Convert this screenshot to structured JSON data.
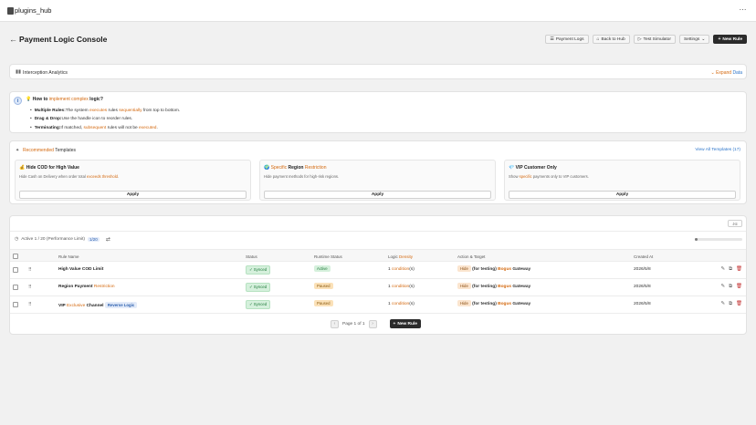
{
  "app": {
    "title": "plugins_hub",
    "menu_icon": "⋯"
  },
  "header": {
    "title": "Payment Logic Console",
    "buttons": [
      {
        "icon": "☰",
        "label": "Payment Logs"
      },
      {
        "icon": "⌂",
        "label": "Back to Hub"
      },
      {
        "icon": "▷",
        "label": "Test Simulator"
      },
      {
        "icon": "",
        "label": "Settings"
      }
    ],
    "new_rule": "New Rule"
  },
  "analytics": {
    "title": "Interception Analytics",
    "expand_a": "Expand",
    "expand_b": "Data"
  },
  "howto": {
    "title_a": "How to",
    "title_b": "implement complex",
    "title_c": "logic?",
    "tips": [
      {
        "bold": "Multiple Rules:",
        "a": "The system ",
        "b": "executes",
        "c": " rules ",
        "d": "sequentially",
        "e": " from top to bottom."
      },
      {
        "bold": "Drag & Drop:",
        "a": "Use the handle icon to reorder rules.",
        "b": "",
        "c": "",
        "d": "",
        "e": ""
      },
      {
        "bold": "Terminating:",
        "a": "If matched, ",
        "b": "subsequent",
        "c": " rules will not be ",
        "d": "executed",
        "e": "."
      }
    ]
  },
  "templates": {
    "title_a": "Recommended",
    "title_b": "Templates",
    "view_all": "View All Templates (17)",
    "apply_label": "Apply",
    "items": [
      {
        "icon": "💰",
        "name_a": "Hide COD for High Value",
        "name_b": "",
        "name_c": "",
        "desc_a": "Hide Cash on Delivery when order total ",
        "desc_b": "exceeds threshold",
        "desc_c": "."
      },
      {
        "icon": "🌍",
        "name_a": "",
        "name_b": "Specific",
        "name_c": " Region ",
        "name_d": "Restriction",
        "desc_a": "Hide payment methods for high-risk regions.",
        "desc_b": "",
        "desc_c": ""
      },
      {
        "icon": "💎",
        "name_a": "VIP Customer Only",
        "name_b": "",
        "name_c": "",
        "desc_a": "Show ",
        "desc_b": "specific",
        "desc_c": " payments only to VIP customers."
      }
    ]
  },
  "rules": {
    "status_text": "Active 1 / 20 (Performance Limit)",
    "count_pill": "1/20",
    "progress_fraction": 0.05,
    "columns": [
      "Rule Name",
      "Status",
      "Runtime Status",
      "Logic",
      "Density",
      "Action & Target",
      "Created At"
    ],
    "rows": [
      {
        "name_a": "High Value COD Limit",
        "name_b": "",
        "name_c": "",
        "tag": "",
        "status": "✓  Synced",
        "runtime": "Active",
        "runtime_type": "active",
        "logic_a": "1 ",
        "logic_b": "condition",
        "logic_c": "(s)",
        "action": "Hide",
        "target_a": " (for testing) ",
        "target_b": "Bogus",
        "target_c": " Gateway",
        "created": "2026/5/8"
      },
      {
        "name_a": "Region Payment ",
        "name_b": "Restriction",
        "name_c": "",
        "tag": "",
        "status": "✓  Synced",
        "runtime": "Paused",
        "runtime_type": "paused",
        "logic_a": "1 ",
        "logic_b": "condition",
        "logic_c": "(s)",
        "action": "Hide",
        "target_a": " (for testing) ",
        "target_b": "Bogus",
        "target_c": " Gateway",
        "created": "2026/5/8"
      },
      {
        "name_a": "VIP ",
        "name_b": "Exclusive",
        "name_c": " Channel",
        "tag": "Reverse Logic",
        "status": "✓  Synced",
        "runtime": "Paused",
        "runtime_type": "paused",
        "logic_a": "1 ",
        "logic_b": "condition",
        "logic_c": "(s)",
        "action": "Hide",
        "target_a": " (for testing) ",
        "target_b": "Bogus",
        "target_c": " Gateway",
        "created": "2026/5/8"
      }
    ],
    "pager": {
      "label": "Page 1 of 1",
      "prev": "‹",
      "next": "›",
      "new_rule": "New Rule"
    }
  },
  "colors": {
    "accent": "#d4690f",
    "link_blue": "#2b74c9",
    "primary_dark": "#2b2b2b"
  }
}
